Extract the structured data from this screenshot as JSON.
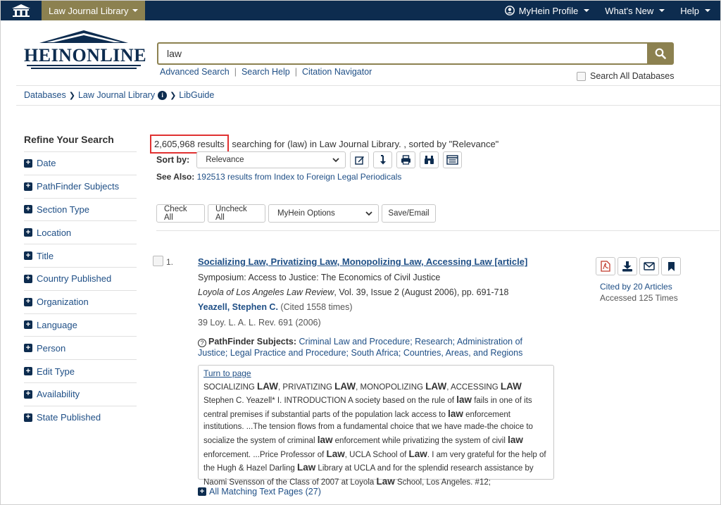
{
  "topbar": {
    "library_label": "Law Journal Library",
    "profile_label": "MyHein Profile",
    "whats_new_label": "What's New",
    "help_label": "Help"
  },
  "header": {
    "logo_text": "HEINONLINE",
    "search_value": "law",
    "links": [
      "Advanced Search",
      "Search Help",
      "Citation Navigator"
    ],
    "search_all_label": "Search All Databases"
  },
  "breadcrumb": [
    "Databases",
    "Law Journal Library",
    "LibGuide"
  ],
  "sidebar": {
    "title": "Refine Your Search",
    "facets": [
      "Date",
      "PathFinder Subjects",
      "Section Type",
      "Location",
      "Title",
      "Country Published",
      "Organization",
      "Language",
      "Person",
      "Edit Type",
      "Availability",
      "State Published"
    ]
  },
  "results": {
    "count": "2,605,968 results",
    "summary": "searching for (law) in Law Journal Library. , sorted by \"Relevance\"",
    "sort_label": "Sort by:",
    "sort_value": "Relevance",
    "see_also_label": "See Also:",
    "see_also_link": "192513 results from Index to Foreign Legal Periodicals",
    "actions": [
      "Check All",
      "Uncheck All"
    ],
    "myhein_options": "MyHein Options",
    "save_email": "Save/Email"
  },
  "result": {
    "number": "1.",
    "title": "Socializing Law, Privatizing Law, Monopolizing Law, Accessing Law [article]",
    "symposium": "Symposium: Access to Justice: The Economics of Civil Justice",
    "journal": "Loyola of Los Angeles Law Review",
    "journal_rest": ", Vol. 39, Issue 2 (August 2006), pp. 691-718",
    "author": "Yeazell, Stephen C.",
    "author_cited": "(Cited 1558 times)",
    "citation": "39 Loy. L. A. L. Rev. 691 (2006)",
    "subjects_label": "PathFinder Subjects:",
    "subjects": "Criminal Law and Procedure; Research; Administration of Justice; Legal Practice and Procedure; South Africa; Countries, Areas, and Regions",
    "cited_by": "Cited by 20 Articles",
    "accessed": "Accessed 125 Times",
    "turn_to_page": "Turn to page",
    "all_matching": "All Matching Text Pages (27)"
  },
  "colors": {
    "navy": "#0d2c4f",
    "gold": "#8c8150",
    "link": "#1f4f86",
    "highlight_border": "#e03131"
  },
  "icons": [
    "home-icon",
    "user-icon",
    "search-icon",
    "info-icon",
    "edit-icon",
    "sort-icon",
    "print-icon",
    "binoculars-icon",
    "list-icon",
    "pdf-icon",
    "download-icon",
    "email-icon",
    "bookmark-icon",
    "plus-icon",
    "question-icon"
  ]
}
